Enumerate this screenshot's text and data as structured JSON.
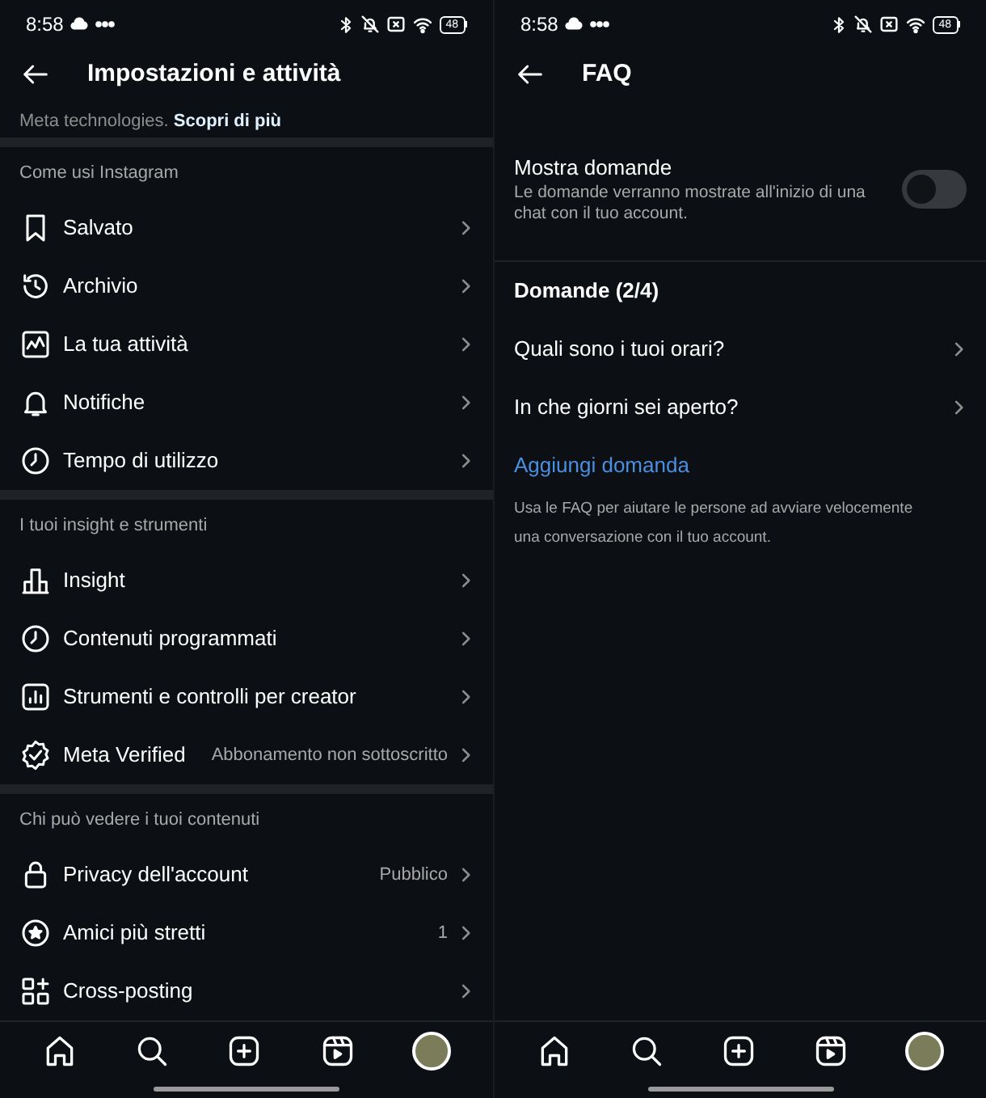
{
  "settings_screen": {
    "status_bar": {
      "time": "8:58",
      "battery": "48"
    },
    "header": {
      "title": "Impostazioni e attività"
    },
    "intro": {
      "text": "Meta technologies.",
      "link": "Scopri di più"
    },
    "sections": [
      {
        "title": "Come usi Instagram",
        "items": [
          {
            "label": "Salvato"
          },
          {
            "label": "Archivio"
          },
          {
            "label": "La tua attività"
          },
          {
            "label": "Notifiche"
          },
          {
            "label": "Tempo di utilizzo"
          }
        ]
      },
      {
        "title": "I tuoi insight e strumenti",
        "items": [
          {
            "label": "Insight"
          },
          {
            "label": "Contenuti programmati"
          },
          {
            "label": "Strumenti e controlli per creator"
          },
          {
            "label": "Meta Verified",
            "value": "Abbonamento non sottoscritto"
          }
        ]
      },
      {
        "title": "Chi può vedere i tuoi contenuti",
        "items": [
          {
            "label": "Privacy dell'account",
            "value": "Pubblico"
          },
          {
            "label": "Amici più stretti",
            "value": "1"
          },
          {
            "label": "Cross-posting"
          }
        ]
      }
    ]
  },
  "faq_screen": {
    "status_bar": {
      "time": "8:58",
      "battery": "48"
    },
    "header": {
      "title": "FAQ"
    },
    "toggle": {
      "label": "Mostra domande",
      "description": "Le domande verranno mostrate all'inizio di una chat con il tuo account.",
      "on": false
    },
    "questions_heading": "Domande (2/4)",
    "questions": [
      {
        "label": "Quali sono i tuoi orari?"
      },
      {
        "label": "In che giorni sei aperto?"
      }
    ],
    "add_link": "Aggiungi domanda",
    "note": "Usa le FAQ per aiutare le persone ad avviare velocemente una conversazione con il tuo account."
  }
}
